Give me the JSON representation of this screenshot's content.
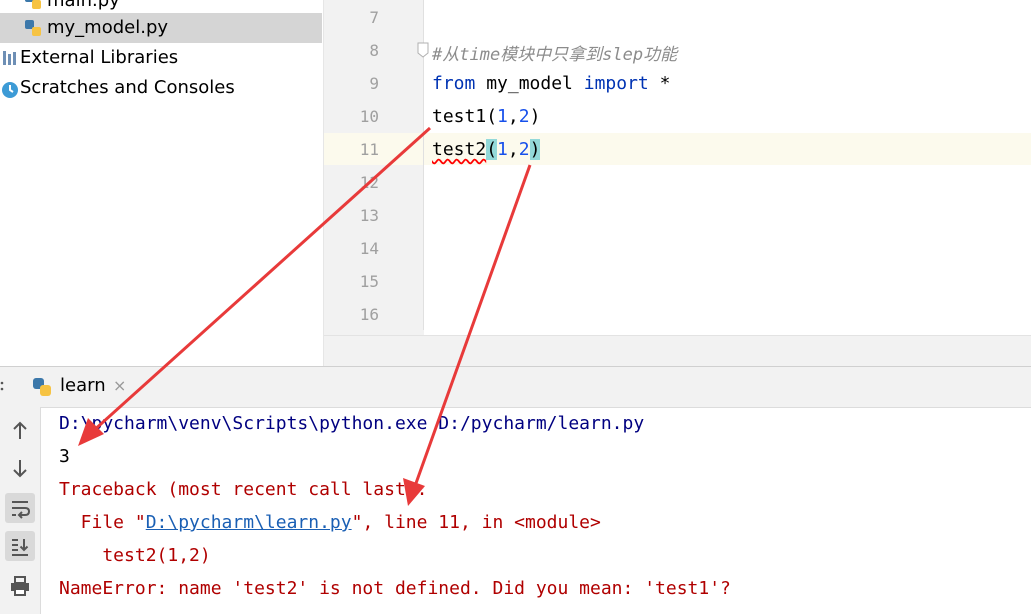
{
  "project_tree": {
    "items": [
      {
        "label": "main.py"
      },
      {
        "label": "my_model.py"
      },
      {
        "label": "External Libraries"
      },
      {
        "label": "Scratches and Consoles"
      }
    ]
  },
  "editor": {
    "line_numbers": [
      "7",
      "8",
      "9",
      "10",
      "11",
      "12",
      "13",
      "14",
      "15",
      "16"
    ],
    "comment": "#从time模块中只拿到slep功能",
    "kw_from": "from",
    "module": " my_model ",
    "kw_import": "import",
    "star": " *",
    "call1_name": "test1",
    "call2_name": "test2",
    "open_paren": "(",
    "arg1": "1",
    "comma": ",",
    "arg2": "2",
    "close_paren": ")"
  },
  "run_panel": {
    "tab_label": "learn",
    "close_glyph": "×",
    "output": {
      "cmd": "D:\\pycharm\\venv\\Scripts\\python.exe D:/pycharm/learn.py",
      "result": "3",
      "traceback": "Traceback (most recent call last):",
      "file_prefix": "  File \"",
      "file_link": "D:\\pycharm\\learn.py",
      "file_suffix": "\", line 11, in <module>",
      "code_line": "    test2(1,2)",
      "error": "NameError: name 'test2' is not defined. Did you mean: 'test1'?"
    },
    "toolbar_icons": [
      "arrow-up-icon",
      "arrow-down-icon",
      "soft-wrap-icon",
      "scroll-to-end-icon",
      "print-icon"
    ]
  },
  "colors": {
    "keyword": "#0033b3",
    "number": "#1750eb",
    "error_text": "#b00000",
    "link": "#1a5fb4",
    "annotation_arrow": "#e83a3a"
  }
}
